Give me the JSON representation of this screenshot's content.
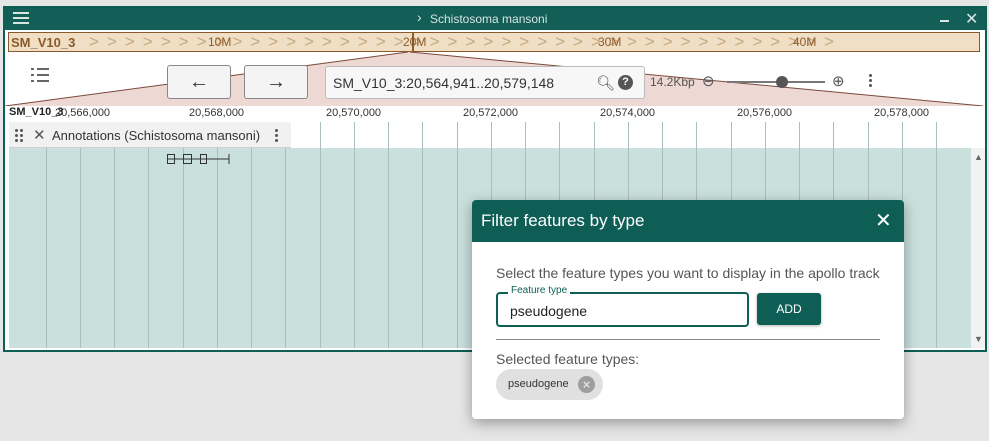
{
  "window": {
    "title": "Schistosoma mansoni",
    "menu_icon": "hamburger-icon",
    "minimize_icon": "minimize-icon",
    "close_icon": "close-icon"
  },
  "overview": {
    "ref_name": "SM_V10_3",
    "ticks": [
      "10M",
      "20M",
      "30M",
      "40M"
    ]
  },
  "toolbar": {
    "location": "SM_V10_3:20,564,941..20,579,148",
    "region_size": "14.2Kbp",
    "back_icon": "arrow-left-icon",
    "forward_icon": "arrow-right-icon"
  },
  "ruler": {
    "ref_name": "SM_V10_3",
    "labels": [
      "20,566,000",
      "20,568,000",
      "20,570,000",
      "20,572,000",
      "20,574,000",
      "20,576,000",
      "20,578,000"
    ]
  },
  "track": {
    "name": "Annotations (Schistosoma mansoni)"
  },
  "dialog": {
    "title": "Filter features by type",
    "description": "Select the feature types you want to display in the apollo track",
    "feature_type_label": "Feature type",
    "feature_type_value": "pseudogene",
    "add_label": "ADD",
    "selected_label": "Selected feature types:",
    "chips": [
      "pseudogene"
    ]
  },
  "colors": {
    "primary": "#0e5e56",
    "overview_bg": "#f0dfc4",
    "track_bg": "#c9e0dd"
  }
}
